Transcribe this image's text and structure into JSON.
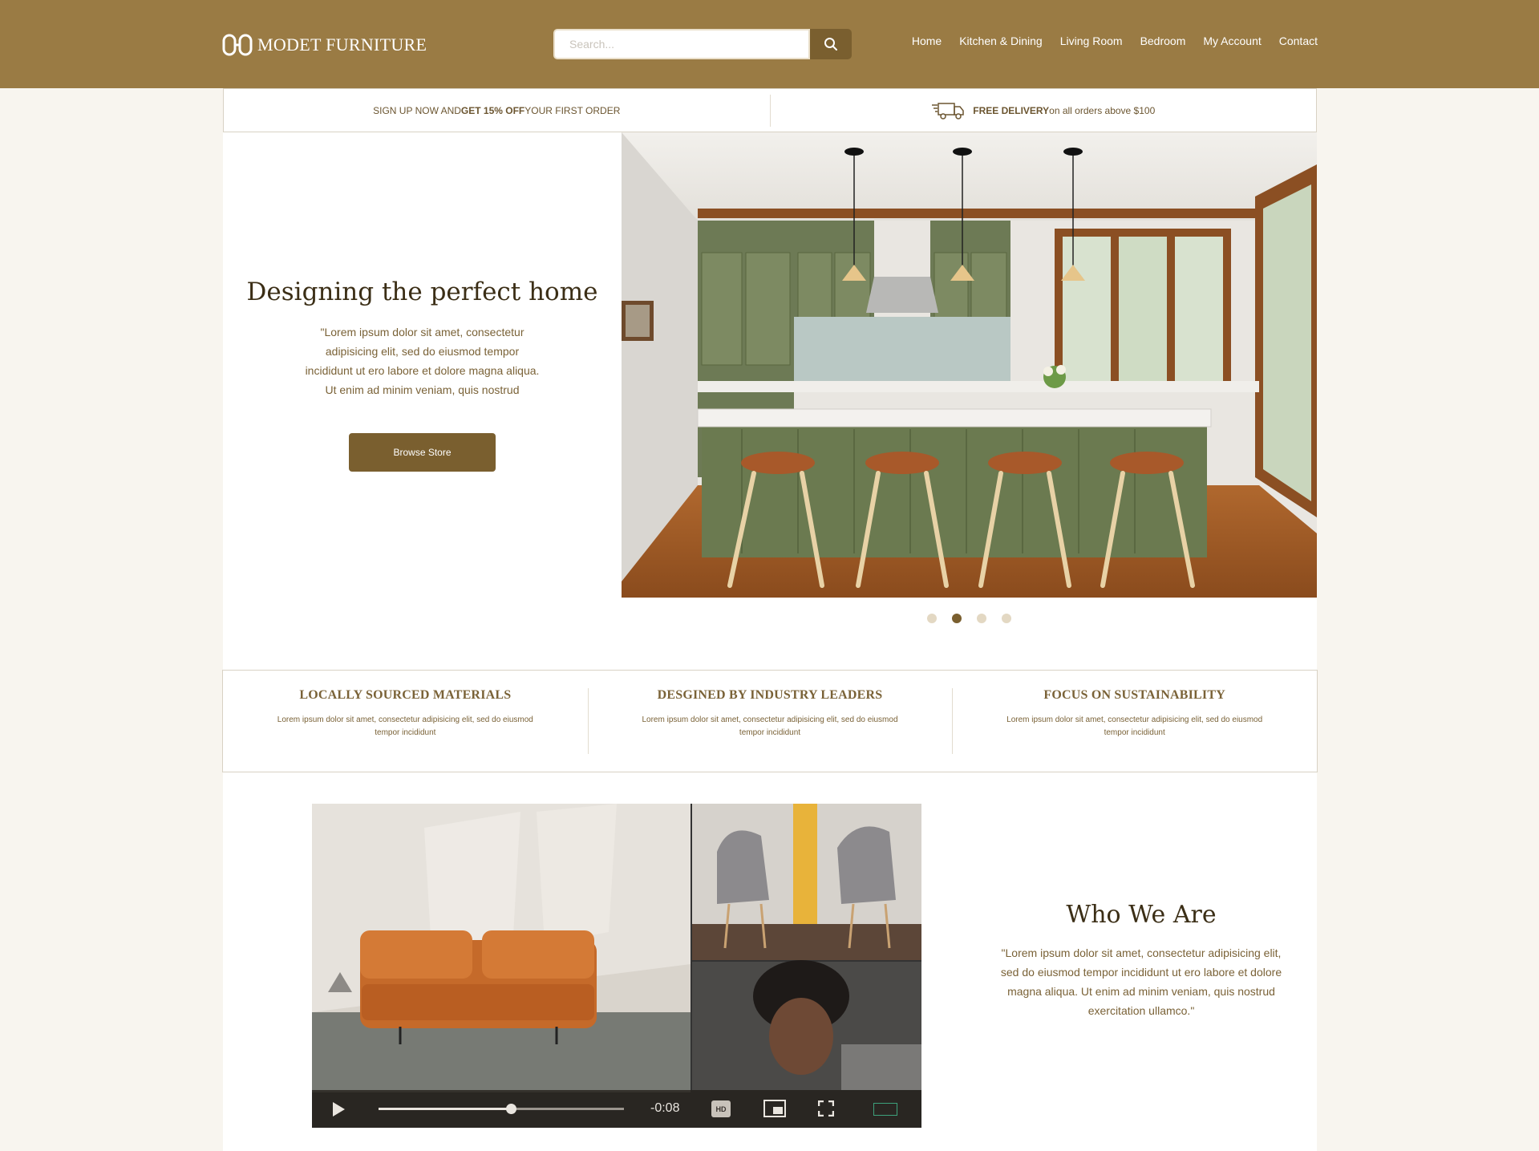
{
  "brand": {
    "name": "MODET FURNITURE"
  },
  "search": {
    "placeholder": "Search..."
  },
  "nav": {
    "items": [
      "Home",
      "Kitchen & Dining",
      "Living Room",
      "Bedroom",
      "My Account",
      "Contact"
    ]
  },
  "promo": {
    "signup_prefix": "SIGN UP NOW AND ",
    "signup_bold": "GET 15% OFF",
    "signup_suffix": " YOUR FIRST ORDER",
    "delivery_bold": "FREE DELIVERY",
    "delivery_suffix": " on all orders above $100"
  },
  "hero": {
    "title": "Designing the perfect home",
    "text": "\"Lorem ipsum dolor sit amet, consectetur adipisicing elit, sed do eiusmod tempor incididunt ut ero labore et dolore magna aliqua. Ut enim ad minim veniam, quis nostrud",
    "button": "Browse Store",
    "slides": 4,
    "active_slide": 2
  },
  "features": [
    {
      "title": "LOCALLY SOURCED MATERIALS",
      "text": "Lorem ipsum dolor sit amet, consectetur adipisicing elit, sed do eiusmod tempor incididunt"
    },
    {
      "title": "DESGINED BY INDUSTRY LEADERS",
      "text": "Lorem ipsum dolor sit amet, consectetur adipisicing elit, sed do eiusmod tempor incididunt"
    },
    {
      "title": "FOCUS ON SUSTAINABILITY",
      "text": "Lorem ipsum dolor sit amet, consectetur adipisicing elit, sed do eiusmod tempor incididunt"
    }
  ],
  "video": {
    "time": "-0:08",
    "hd_label": "HD",
    "progress": 0.54
  },
  "who": {
    "title": "Who We Are",
    "text": "\"Lorem ipsum dolor sit amet, consectetur adipisicing elit, sed do eiusmod tempor incididunt ut ero labore et dolore magna aliqua. Ut enim ad minim veniam, quis nostrud exercitation ullamco.\""
  },
  "colors": {
    "header": "#9a7b44",
    "accent": "#7a5f2f",
    "page_bg": "#f8f5ef"
  }
}
